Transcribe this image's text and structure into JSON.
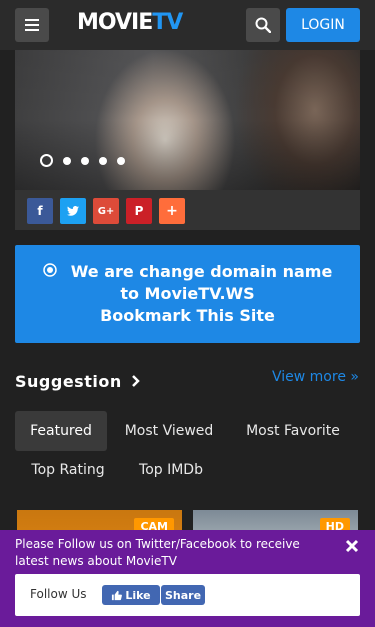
{
  "header": {
    "logo_part1": "MOVIE",
    "logo_part2": "TV",
    "login_label": "LOGIN",
    "menu_icon": "hamburger-icon",
    "search_icon": "search-icon"
  },
  "slider": {
    "slide_count": 5,
    "active_index": 0
  },
  "share": {
    "facebook_label": "f",
    "twitter_icon": "twitter-icon",
    "google_label": "G+",
    "pinterest_label": "P",
    "more_label": "+"
  },
  "notice": {
    "line1": "We are change domain name",
    "line2": "to MovieTV.WS",
    "line3": "Bookmark This Site",
    "icon": "target-icon"
  },
  "suggestion": {
    "title": "Suggestion",
    "view_more": "View more »",
    "tabs": [
      {
        "label": "Featured",
        "active": true
      },
      {
        "label": "Most Viewed",
        "active": false
      },
      {
        "label": "Most Favorite",
        "active": false
      },
      {
        "label": "Top Rating",
        "active": false
      },
      {
        "label": "Top IMDb",
        "active": false
      }
    ]
  },
  "cards": [
    {
      "badge": "CAM",
      "badge_color": "#ff9800"
    },
    {
      "badge": "HD",
      "badge_color": "#ff9800"
    }
  ],
  "follow": {
    "text": "Please Follow us on Twitter/Facebook to receive latest news about MovieTV",
    "label": "Follow Us",
    "like_label": "Like",
    "share_label": "Share"
  },
  "colors": {
    "accent": "#1e88e5",
    "follow_bg": "#6a1b9a",
    "facebook": "#3b5998",
    "twitter": "#1da1f2",
    "google": "#dd4b39",
    "pinterest": "#cb2027",
    "more": "#ff6d3b"
  }
}
